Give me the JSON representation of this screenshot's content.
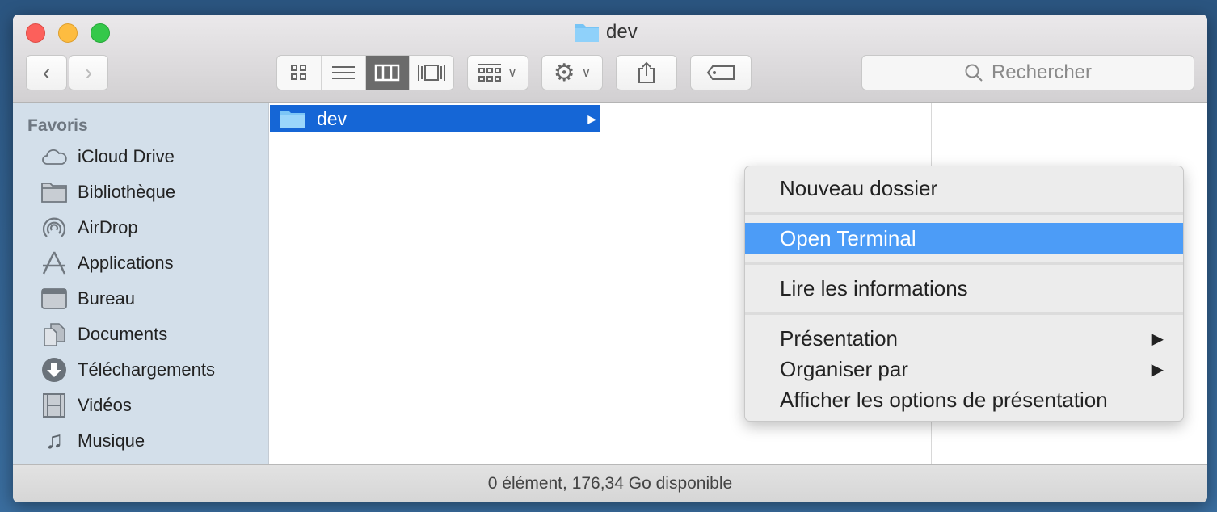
{
  "window": {
    "title": "dev"
  },
  "toolbar": {
    "search_placeholder": "Rechercher",
    "views": [
      "icon-view",
      "list-view",
      "column-view",
      "cover-flow-view"
    ],
    "selected_view": "column-view"
  },
  "sidebar": {
    "heading": "Favoris",
    "items": [
      {
        "label": "iCloud Drive",
        "icon": "cloud-icon"
      },
      {
        "label": "Bibliothèque",
        "icon": "folder-icon"
      },
      {
        "label": "AirDrop",
        "icon": "airdrop-icon"
      },
      {
        "label": "Applications",
        "icon": "applications-icon"
      },
      {
        "label": "Bureau",
        "icon": "desktop-icon"
      },
      {
        "label": "Documents",
        "icon": "documents-icon"
      },
      {
        "label": "Téléchargements",
        "icon": "download-icon"
      },
      {
        "label": "Vidéos",
        "icon": "film-icon"
      },
      {
        "label": "Musique",
        "icon": "music-icon"
      }
    ]
  },
  "columns": {
    "selected_item": "dev"
  },
  "status": "0 élément, 176,34 Go disponible",
  "context_menu": {
    "items": [
      "Nouveau dossier",
      "Open Terminal",
      "Lire les informations",
      "Présentation",
      "Organiser par",
      "Afficher les options de présentation"
    ],
    "highlighted": "Open Terminal"
  },
  "colors": {
    "selection": "#1566d6",
    "menu_highlight": "#4c9cf7",
    "sidebar": "#d3dfea"
  }
}
